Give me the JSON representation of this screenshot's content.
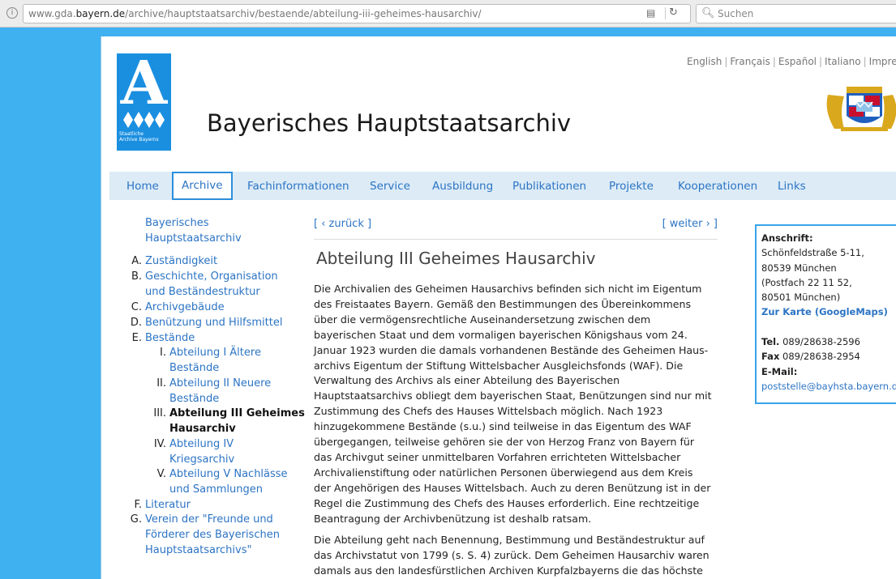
{
  "browser": {
    "url_prefix": "www.gda.",
    "url_domain": "bayern.de",
    "url_path": "/archive/hauptstaatsarchiv/bestaende/abteilung-iii-geheimes-hausarchiv/",
    "search_placeholder": "Suchen"
  },
  "header": {
    "logo_letter": "A",
    "logo_text_1": "Staatliche",
    "logo_text_2": "Archive Bayerns",
    "site_title": "Bayerisches Hauptstaatsarchiv",
    "languages": [
      "English",
      "Français",
      "Español",
      "Italiano",
      "Impres"
    ]
  },
  "nav": {
    "items": [
      "Home",
      "Archive",
      "Fachinformationen",
      "Service",
      "Ausbildung",
      "Publikationen",
      "Projekte",
      "Kooperationen",
      "Links"
    ],
    "active": "Archive"
  },
  "sidebar": {
    "home_1": "Bayerisches",
    "home_2": "Hauptstaatsarchiv",
    "items": [
      {
        "num": "A.",
        "lines": [
          "Zuständigkeit"
        ]
      },
      {
        "num": "B.",
        "lines": [
          "Geschichte, Organisation",
          "und Beständestruktur"
        ]
      },
      {
        "num": "C.",
        "lines": [
          "Archivgebäude"
        ]
      },
      {
        "num": "D.",
        "lines": [
          "Benützung und Hilfsmittel"
        ]
      },
      {
        "num": "E.",
        "lines": [
          "Bestände"
        ]
      },
      {
        "num": "I.",
        "lines": [
          "Abteilung I Ältere",
          "Bestände"
        ]
      },
      {
        "num": "II.",
        "lines": [
          "Abteilung II Neuere",
          "Bestände"
        ]
      },
      {
        "num": "III.",
        "lines": [
          "Abteilung III Geheimes",
          "Hausarchiv"
        ]
      },
      {
        "num": "IV.",
        "lines": [
          "Abteilung IV",
          "Kriegsarchiv"
        ]
      },
      {
        "num": "V.",
        "lines": [
          "Abteilung V Nachlässe",
          "und Sammlungen"
        ]
      },
      {
        "num": "F.",
        "lines": [
          "Literatur"
        ]
      },
      {
        "num": "G.",
        "lines": [
          "Verein der \"Freunde und",
          "Förderer des Bayerischen",
          "Hauptstaatsarchivs\""
        ]
      }
    ]
  },
  "content": {
    "prev": "[ ‹ zurück ]",
    "next": "[ weiter › ]",
    "title": "Abteilung III Geheimes Hausarchiv",
    "para1": [
      "Die Archivalien des Geheimen Hausarchivs befinden sich nicht im Eigentum",
      "des Freistaates Bayern. Gemäß den Bestimmungen des Übereinkommens",
      "über die vermögensrechtliche Auseinandersetzung zwischen dem",
      "bayerischen Staat und dem vormaligen bayerischen Königshaus vom 24.",
      "Januar 1923 wurden die damals vorhandenen Bestände des Geheimen Haus-",
      "archivs Eigentum der Stiftung Wittelsbacher Ausgleichsfonds (WAF). Die",
      "Verwaltung des Archivs als einer Abteilung des Bayerischen",
      "Hauptstaatsarchivs obliegt dem bayerischen Staat, Benützungen sind nur mit",
      "Zustimmung des Chefs des Hauses Wittelsbach möglich. Nach 1923",
      "hinzugekommene Bestände (s.u.) sind teilweise in das Eigentum des WAF",
      "übergegangen, teilweise gehören sie der von Herzog Franz von Bayern für",
      "das Archivgut seiner unmittelbaren Vorfahren errichteten Wittelsbacher",
      "Archivalienstiftung oder natürlichen Personen überwiegend aus dem Kreis",
      "der Angehörigen des Hauses Wittelsbach. Auch zu deren Benützung ist in der",
      "Regel die Zustimmung des Chefs des Hauses erforderlich. Eine rechtzeitige",
      "Beantragung der Archivbenützung ist deshalb ratsam."
    ],
    "para2": [
      "Die Abteilung geht nach Benennung, Bestimmung und Beständestruktur auf",
      "das Archivstatut von 1799 (s. S. 4) zurück. Dem Geheimen Hausarchiv waren",
      "damals aus den landesfürstlichen Archiven Kurpfalzbayerns die    das höchste"
    ]
  },
  "address": {
    "label": "Anschrift:",
    "street": "Schönfeldstraße 5-11,",
    "city": "80539 München",
    "postfach": "(Postfach 22 11 52,",
    "postfach_city": "80501 München)",
    "map_link": "Zur Karte (GoogleMaps)",
    "tel_label": "Tel.",
    "tel": "089/28638-2596",
    "fax_label": "Fax",
    "fax": "089/28638-2954",
    "email_label": "E-Mail:",
    "email": "poststelle@bayhsta.bayern.de"
  },
  "colors": {
    "background": "#3fb0f0",
    "link": "#2c74c4",
    "nav_bg": "#dcebf6",
    "accent": "#2c8fdd"
  }
}
